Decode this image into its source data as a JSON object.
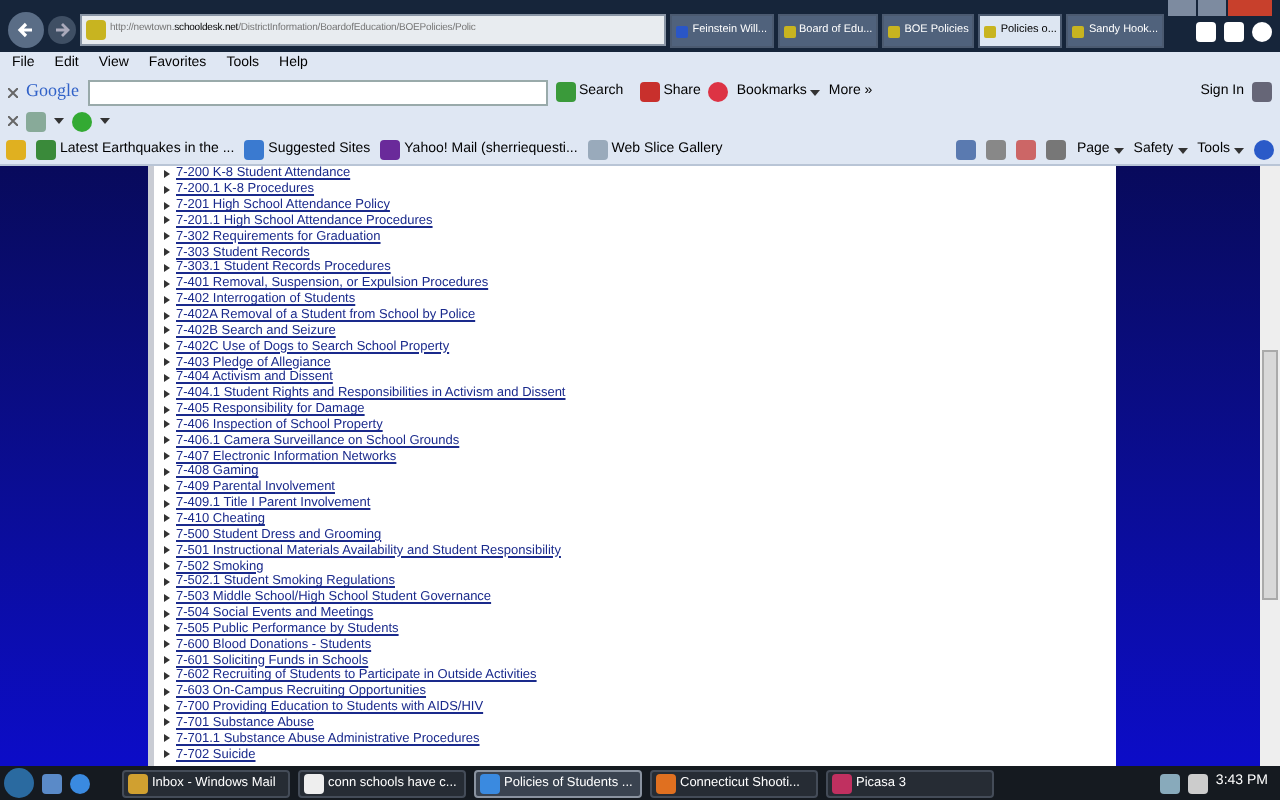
{
  "address_bar": {
    "url_prefix": "http://newtown.",
    "url_domain": "schooldesk.net",
    "url_path": "/DistrictInformation/BoardofEducation/BOEPolicies/Polic"
  },
  "tabs": [
    {
      "label": "Feinstein Will...",
      "selected": false
    },
    {
      "label": "Board of Edu...",
      "selected": false
    },
    {
      "label": "BOE Policies",
      "selected": false
    },
    {
      "label": "Policies o...",
      "selected": true
    },
    {
      "label": "Sandy Hook...",
      "selected": false
    }
  ],
  "menu": [
    "File",
    "Edit",
    "View",
    "Favorites",
    "Tools",
    "Help"
  ],
  "google_toolbar": {
    "logo": "Google",
    "search": "Search",
    "share": "Share",
    "bookmarks": "Bookmarks",
    "more": "More »",
    "sign_in": "Sign In"
  },
  "favorites": [
    {
      "label": "Latest Earthquakes in the ..."
    },
    {
      "label": "Suggested Sites"
    },
    {
      "label": "Yahoo! Mail (sherriequesti..."
    },
    {
      "label": "Web Slice Gallery"
    }
  ],
  "command_bar": [
    "Page",
    "Safety",
    "Tools"
  ],
  "policies": [
    "7-200 K-8 Student Attendance",
    "7-200.1 K-8 Procedures",
    "7-201 High School Attendance Policy",
    "7-201.1 High School Attendance Procedures",
    "7-302 Requirements for Graduation",
    "7-303 Student Records",
    "7-303.1 Student Records Procedures",
    "7-401 Removal, Suspension, or Expulsion Procedures",
    "7-402 Interrogation of Students",
    "7-402A Removal of a Student from School by Police",
    "7-402B Search and Seizure",
    "7-402C Use of Dogs to Search School Property",
    "7-403 Pledge of Allegiance",
    "7-404 Activism and Dissent",
    "7-404.1 Student Rights and Responsibilities in Activism and Dissent",
    "7-405 Responsibility for Damage",
    "7-406 Inspection of School Property",
    "7-406.1 Camera Surveillance on School Grounds",
    "7-407 Electronic Information Networks",
    "7-408 Gaming",
    "7-409 Parental Involvement",
    "7-409.1 Title I Parent Involvement",
    "7-410 Cheating",
    "7-500 Student Dress and Grooming",
    "7-501 Instructional Materials Availability and Student Responsibility",
    "7-502 Smoking",
    "7-502.1 Student Smoking Regulations",
    "7-503 Middle School/High School Student Governance",
    "7-504 Social Events and Meetings",
    "7-505 Public Performance by Students",
    "7-600 Blood Donations - Students",
    "7-601 Soliciting Funds in Schools",
    "7-602 Recruiting of Students to Participate in Outside Activities",
    "7-603 On-Campus Recruiting Opportunities",
    "7-700 Providing Education to Students with AIDS/HIV",
    "7-701 Substance Abuse",
    "7-701.1 Substance Abuse Administrative Procedures",
    "7-702 Suicide"
  ],
  "taskbar": {
    "items": [
      {
        "label": "Inbox - Windows Mail",
        "selected": false
      },
      {
        "label": "conn schools have c...",
        "selected": false
      },
      {
        "label": "Policies of Students ...",
        "selected": true
      },
      {
        "label": "Connecticut Shooti...",
        "selected": false
      },
      {
        "label": "Picasa 3",
        "selected": false
      }
    ],
    "clock": "3:43 PM"
  }
}
